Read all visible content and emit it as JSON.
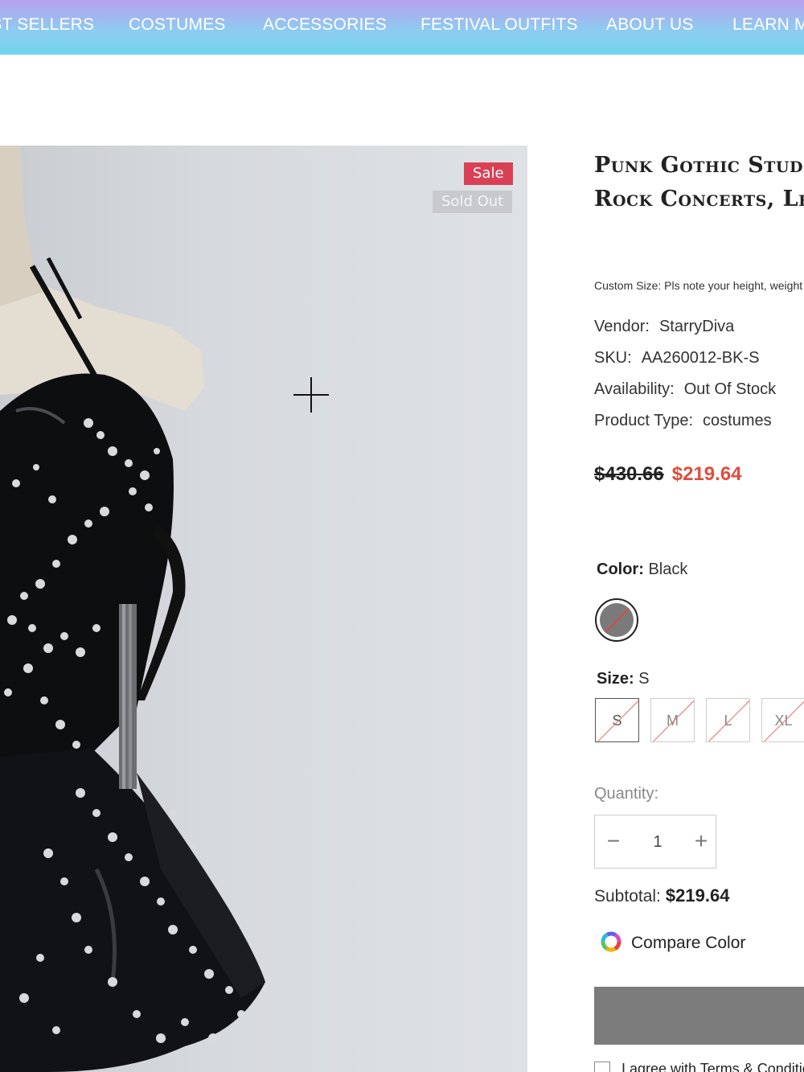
{
  "nav": {
    "items": [
      "BEST SELLERS",
      "COSTUMES",
      "ACCESSORIES",
      "FESTIVAL OUTFITS",
      "ABOUT US",
      "LEARN MORE"
    ]
  },
  "gallery": {
    "badges": {
      "sale": "Sale",
      "sold_out": "Sold Out"
    }
  },
  "product": {
    "title_line1": "Punk Gothic Studded",
    "title_line2": "Rock Concerts, Le",
    "custom_size_note": "Custom Size: Pls note your height, weight",
    "vendor_label": "Vendor:",
    "vendor": "StarryDiva",
    "sku_label": "SKU:",
    "sku": "AA260012-BK-S",
    "availability_label": "Availability:",
    "availability": "Out Of Stock",
    "type_label": "Product Type:",
    "type": "costumes",
    "price_original": "$430.66",
    "price_sale": "$219.64"
  },
  "options": {
    "color_label": "Color:",
    "color_value": "Black",
    "size_label": "Size:",
    "size_value": "S",
    "sizes": [
      "S",
      "M",
      "L",
      "XL"
    ]
  },
  "quantity": {
    "label": "Quantity:",
    "value": "1",
    "minus": "−",
    "plus": "+"
  },
  "subtotal": {
    "label": "Subtotal:",
    "value": "$219.64"
  },
  "compare": {
    "label": "Compare Color"
  },
  "terms": {
    "label": "I agree with Terms & Conditions"
  },
  "colors": {
    "sale_badge": "#d94055",
    "price_sale": "#e04d3d",
    "add_to_cart_disabled": "#7c7c7c"
  }
}
